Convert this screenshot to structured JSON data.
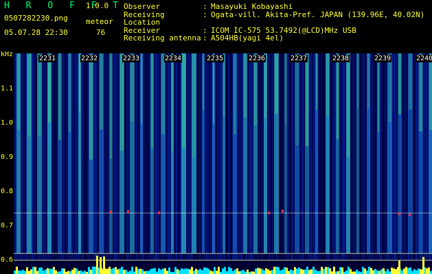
{
  "header": {
    "title": "H R O F F T",
    "version": "1.0.0",
    "filename": "0507282230.png",
    "datetime": "05.07.28 22:30",
    "meteor_label": "meteor",
    "meteor_count": "76"
  },
  "info": [
    {
      "key": "Observer",
      "value": "Masayuki Kobayashi"
    },
    {
      "key": "Receiving Location",
      "value": "Ogata-vill. Akita-Pref. JAPAN (139.96E, 40.02N)"
    },
    {
      "key": "Receiver",
      "value": "ICOM IC-575 53.7492(@LCD)MHz USB"
    },
    {
      "key": "Receiving antenna",
      "value": "A504HB(yagi 4el)"
    }
  ],
  "axis": {
    "unit": "kHz",
    "y_ticks": [
      "1.1",
      "1.0",
      "0.9",
      "0.8",
      "0.7",
      "0.6"
    ],
    "time_labels": [
      "2231",
      "2232",
      "2233",
      "2234",
      "2235",
      "2236",
      "2237",
      "2238",
      "2239",
      "2240"
    ]
  },
  "colors": {
    "label_yellow": "#ffff33",
    "title_green": "#00ff66",
    "background": "#000000"
  }
}
